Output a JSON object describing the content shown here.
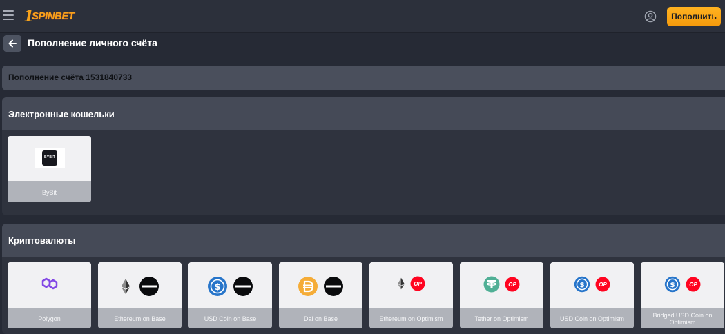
{
  "header": {
    "logo_number": "1",
    "logo_text": "SPINBET",
    "deposit_label": "Пополнить"
  },
  "page": {
    "title": "Пополнение личного счёта",
    "account_text": "Пополнение счёта 1531840733"
  },
  "sections": {
    "ewallets": {
      "title": "Электронные кошельки",
      "items": [
        {
          "label": "ByBit",
          "logo_text": "BYBIT",
          "icon": "bybit-logo"
        }
      ]
    },
    "crypto": {
      "title": "Криптовалюты",
      "items": [
        {
          "label": "Polygon",
          "icon": "polygon-icon"
        },
        {
          "label": "Ethereum on Base",
          "icon": "ethereum-base-icon"
        },
        {
          "label": "USD Coin on Base",
          "icon": "usdc-base-icon"
        },
        {
          "label": "Dai on Base",
          "icon": "dai-base-icon"
        },
        {
          "label": "Ethereum on Optimism",
          "icon": "ethereum-optimism-icon"
        },
        {
          "label": "Tether on Optimism",
          "icon": "tether-optimism-icon"
        },
        {
          "label": "USD Coin on Optimism",
          "icon": "usdc-optimism-icon"
        },
        {
          "label": "Bridged USD Coin on Optimism",
          "icon": "bridged-usdc-optimism-icon"
        }
      ]
    }
  },
  "badges": {
    "optimism": "OP"
  },
  "colors": {
    "accent": "#f7a21b",
    "background": "#262a35",
    "section_header": "#454a57",
    "card": "#f1f1f3",
    "card_footer": "#b0b3ba",
    "optimism_red": "#ff0420",
    "usdc_blue": "#2775ca",
    "tether_green": "#50af95",
    "dai_yellow": "#f5ac37",
    "polygon_purple": "#8247e5"
  }
}
